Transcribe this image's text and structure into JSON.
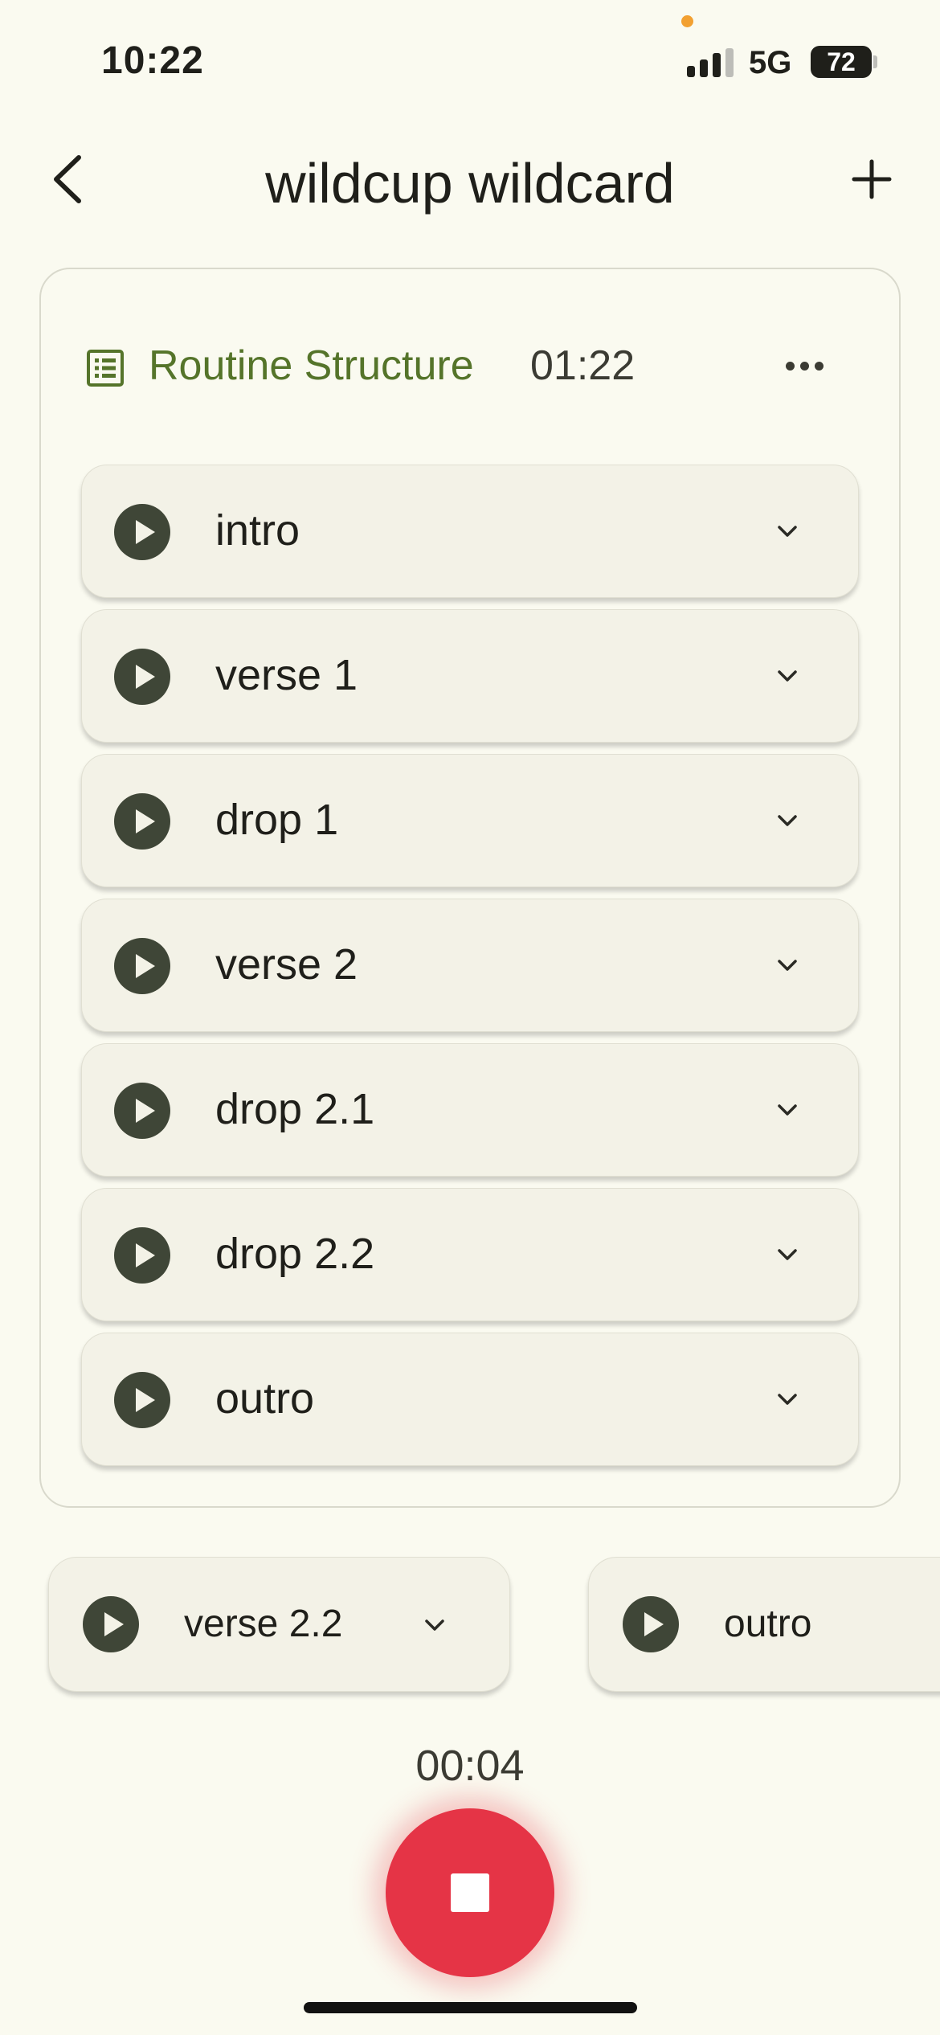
{
  "status_bar": {
    "time": "10:22",
    "network": "5G",
    "battery": "72"
  },
  "header": {
    "title": "wildcup wildcard"
  },
  "routine": {
    "title": "Routine Structure",
    "duration": "01:22",
    "sections": [
      {
        "label": "intro"
      },
      {
        "label": "verse 1"
      },
      {
        "label": "drop 1"
      },
      {
        "label": "verse 2"
      },
      {
        "label": "drop 2.1"
      },
      {
        "label": "drop 2.2"
      },
      {
        "label": "outro"
      }
    ]
  },
  "carousel": {
    "items": [
      {
        "label": "verse 2.2"
      },
      {
        "label": "outro"
      }
    ]
  },
  "recorder": {
    "elapsed": "00:04"
  },
  "colors": {
    "accent_green": "#55742a",
    "record_red": "#e53446",
    "play_dark": "#3f4637",
    "background": "#fafaf0"
  }
}
